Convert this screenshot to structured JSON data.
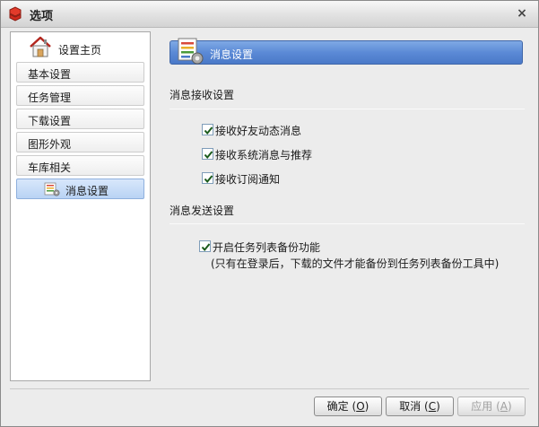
{
  "window": {
    "title": "选项",
    "close_glyph": "×"
  },
  "nav": {
    "home_label": "设置主页",
    "items": [
      {
        "label": "基本设置"
      },
      {
        "label": "任务管理"
      },
      {
        "label": "下载设置"
      },
      {
        "label": "图形外观"
      },
      {
        "label": "车库相关"
      }
    ],
    "selected_sub": {
      "label": "消息设置",
      "icon": "message-settings-icon"
    }
  },
  "content": {
    "header": "消息设置",
    "receive_section": {
      "title": "消息接收设置",
      "options": [
        {
          "label": "接收好友动态消息",
          "checked": true
        },
        {
          "label": "接收系统消息与推荐",
          "checked": true
        },
        {
          "label": "接收订阅通知",
          "checked": true
        }
      ]
    },
    "send_section": {
      "title": "消息发送设置",
      "option": {
        "label": "开启任务列表备份功能",
        "checked": true
      },
      "note": "(只有在登录后，下载的文件才能备份到任务列表备份工具中)"
    }
  },
  "buttons": {
    "ok": {
      "label": "确定",
      "key": "O"
    },
    "cancel": {
      "label": "取消",
      "key": "C"
    },
    "apply": {
      "label": "应用",
      "key": "A"
    }
  },
  "colors": {
    "header_blue": "#5b8ad6",
    "selected_blue": "#b9d3f4"
  }
}
